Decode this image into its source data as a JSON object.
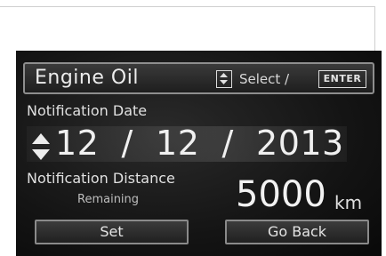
{
  "header": {
    "title": "Engine Oil",
    "select_label": "Select /",
    "enter_key": "ENTER"
  },
  "notification_date": {
    "label": "Notification Date",
    "month": "12",
    "day": "12",
    "year": "2013",
    "separator": "/"
  },
  "notification_distance": {
    "label": "Notification Distance",
    "remaining_label": "Remaining",
    "value": "5000",
    "unit": "km"
  },
  "buttons": {
    "set_label": "Set",
    "go_back_label": "Go Back"
  },
  "icons": {
    "select_updown": "updown-arrows-icon",
    "date_updown": "updown-arrows-icon"
  }
}
